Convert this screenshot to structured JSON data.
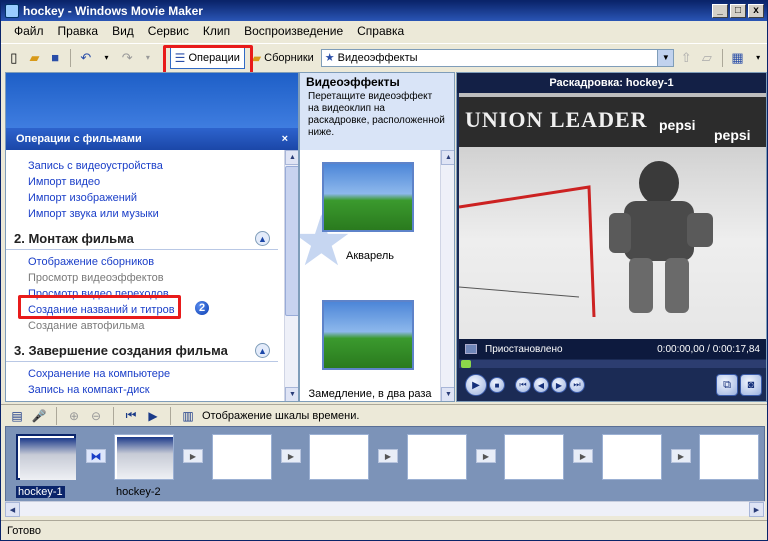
{
  "window": {
    "title": "hockey - Windows Movie Maker",
    "min": "_",
    "max": "□",
    "close": "x"
  },
  "menu": [
    "Файл",
    "Правка",
    "Вид",
    "Сервис",
    "Клип",
    "Воспроизведение",
    "Справка"
  ],
  "toolbar": {
    "operations_label": "Операции",
    "collections_label": "Сборники",
    "effects_select": "Видеоэффекты",
    "badge1": "1"
  },
  "task_pane": {
    "header": "Операции с фильмами",
    "close": "×",
    "capture_links": [
      "Запись с видеоустройства",
      "Импорт видео",
      "Импорт изображений",
      "Импорт звука или музыки"
    ],
    "edit_section": "2. Монтаж фильма",
    "edit_links": [
      "Отображение сборников",
      "Просмотр видеоэффектов",
      "Просмотр видео переходов",
      "Создание названий и титров",
      "Создание автофильма"
    ],
    "finish_section": "3. Завершение создания фильма",
    "finish_links": [
      "Сохранение на компьютере",
      "Запись на компакт-диск"
    ],
    "badge2": "2"
  },
  "effects_pane": {
    "title": "Видеоэффекты",
    "description": "Перетащите видеоэффект на видеоклип на раскадровке, расположенной ниже.",
    "effects": [
      "Акварель",
      "Замедление, в два раза"
    ]
  },
  "monitor": {
    "title": "Раскадровка: hockey-1",
    "banner": "UNION LEADER",
    "ad1": "pepsi",
    "ad2": "pepsi",
    "status": "Приостановлено",
    "time": "0:00:00,00 / 0:00:17,84",
    "progress": 0
  },
  "storyboard_toolbar": {
    "timeline_label": "Отображение шкалы времени."
  },
  "storyboard": {
    "clips": [
      "hockey-1",
      "hockey-2"
    ]
  },
  "statusbar": {
    "text": "Готово"
  }
}
